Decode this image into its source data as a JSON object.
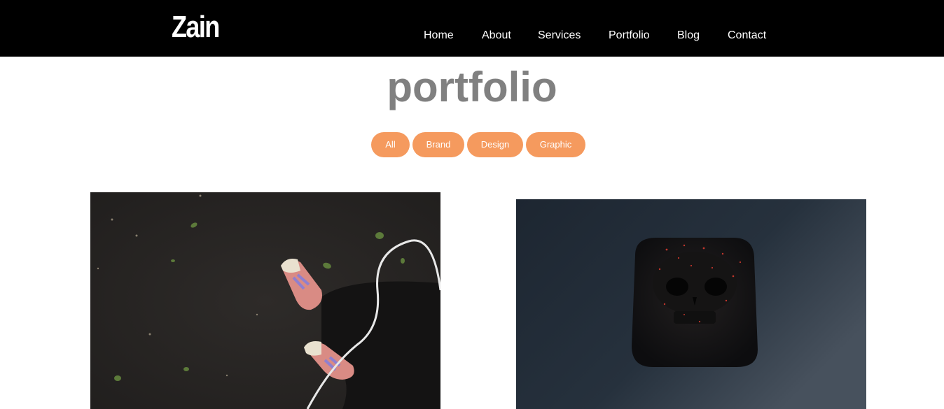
{
  "header": {
    "logo": "Zain",
    "nav": [
      {
        "label": "Home"
      },
      {
        "label": "About"
      },
      {
        "label": "Services"
      },
      {
        "label": "Portfolio"
      },
      {
        "label": "Blog"
      },
      {
        "label": "Contact"
      }
    ]
  },
  "main": {
    "title": "portfolio",
    "filters": [
      {
        "label": "All"
      },
      {
        "label": "Brand"
      },
      {
        "label": "Design"
      },
      {
        "label": "Graphic"
      }
    ]
  },
  "colors": {
    "header_bg": "#000000",
    "accent": "#f59a5e",
    "title": "#808080"
  }
}
